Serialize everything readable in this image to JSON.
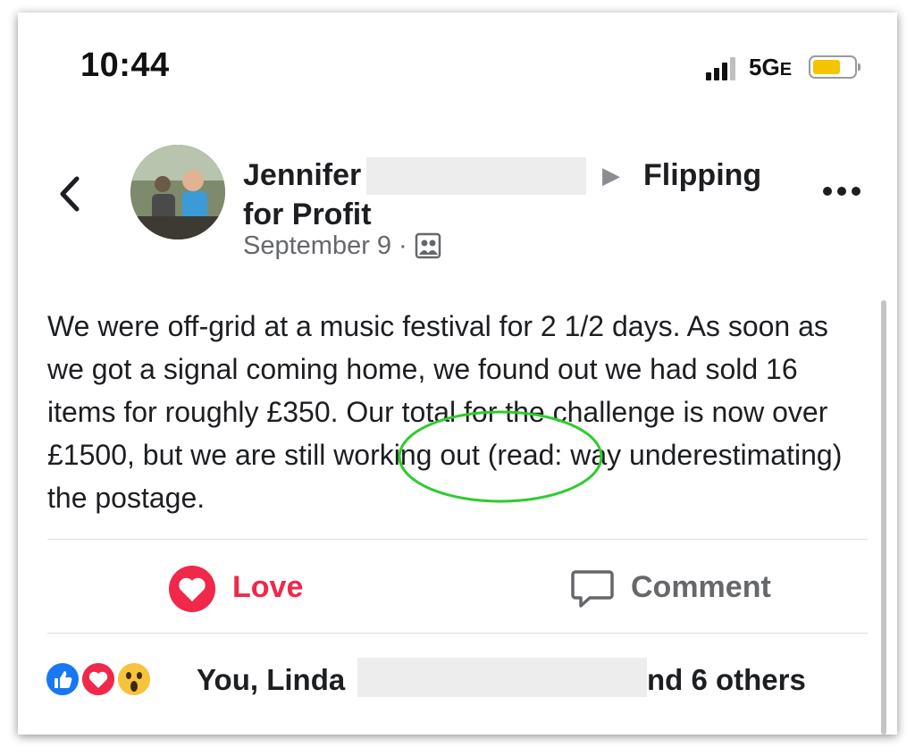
{
  "status_bar": {
    "time": "10:44",
    "network": "5G",
    "network_suffix": "E",
    "battery_color": "#f5c400"
  },
  "post": {
    "author_first": "Jennifer",
    "group_line1": "Flipping",
    "group_line2": "for Profit",
    "date": "September 9",
    "separator": "·",
    "audience_icon": "group-icon",
    "body": "We were off-grid at a music festival for 2 1/2 days. As soon as we got a signal coming home, we found out we had sold 16 items for roughly £350. Our total for the challenge is now over £1500, but we are still working out (read: way underestimating) the postage."
  },
  "actions": {
    "love_label": "Love",
    "comment_label": "Comment",
    "love_color": "#f0284a"
  },
  "reactions": {
    "text_start": "You, Linda",
    "text_end": "nd 6 others",
    "icons": [
      "like-icon",
      "love-icon",
      "wow-icon"
    ]
  },
  "colors": {
    "annotation_circle": "#2ecc2e",
    "muted_text": "#65676b"
  }
}
